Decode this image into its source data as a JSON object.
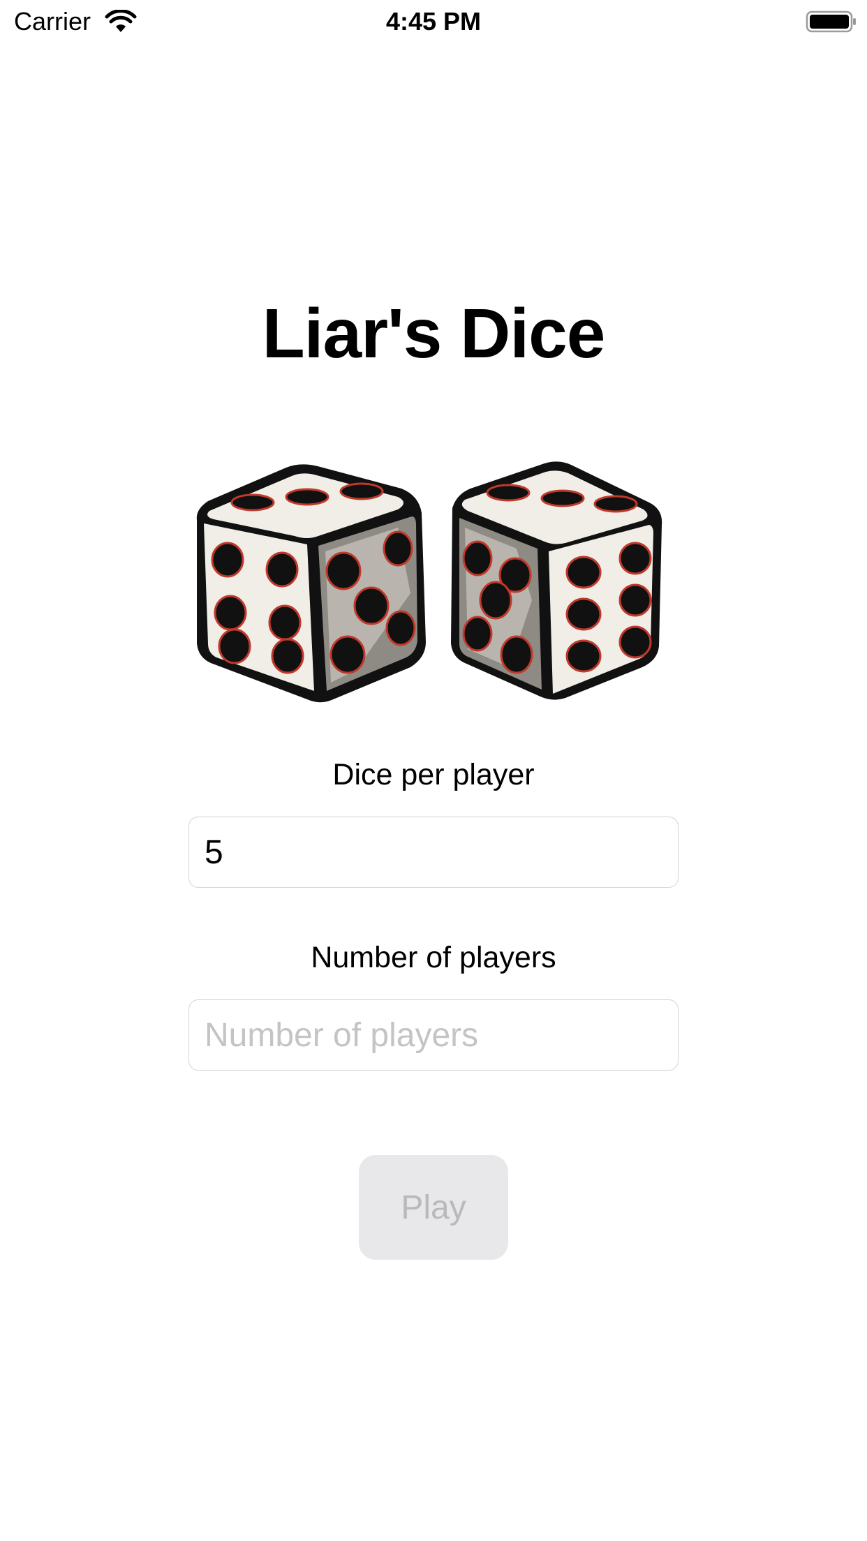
{
  "status_bar": {
    "carrier": "Carrier",
    "time": "4:45 PM",
    "icons": [
      "wifi-icon",
      "battery-icon"
    ]
  },
  "app": {
    "title": "Liar's Dice"
  },
  "dice_image": {
    "icon": "dice-pair-illustration",
    "colors": {
      "outline": "#111111",
      "face": "#f1eee8",
      "shade": "#8e8a84",
      "pip_accent": "#c0392b"
    }
  },
  "form": {
    "dice_per_player": {
      "label": "Dice per player",
      "value": "5",
      "placeholder": ""
    },
    "number_of_players": {
      "label": "Number of players",
      "value": "",
      "placeholder": "Number of players"
    },
    "play_button": {
      "label": "Play",
      "enabled": false
    }
  },
  "colors": {
    "background": "#ffffff",
    "field_border": "#d4d4d6",
    "placeholder": "#c4c4c7",
    "button_bg_disabled": "#e8e8ea",
    "button_text_disabled": "#b9b9bc"
  }
}
